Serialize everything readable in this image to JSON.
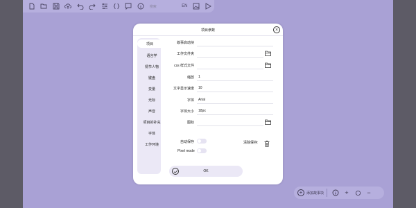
{
  "toolbar": {
    "search_placeholder": "搜索",
    "language": "EN",
    "icons": [
      "new-file-icon",
      "open-folder-icon",
      "save-icon",
      "cloud-upload-icon",
      "undo-icon",
      "redo-icon",
      "sliders-icon",
      "code-braces-icon",
      "comment-icon",
      "info-icon",
      "language-icon",
      "image-icon",
      "play-icon"
    ]
  },
  "dialog": {
    "title": "项目参数",
    "close_icon": "close-icon",
    "sidebar": {
      "items": [
        {
          "label": "项目",
          "active": true
        },
        {
          "label": "语言学"
        },
        {
          "label": "情节人物"
        },
        {
          "label": "键盘"
        },
        {
          "label": "变量"
        },
        {
          "label": "光标"
        },
        {
          "label": "声音"
        },
        {
          "label": "项目的补充"
        },
        {
          "label": "字体"
        },
        {
          "label": "工作环境"
        }
      ]
    },
    "fields": {
      "start_block": {
        "label": "故事启动块",
        "value": ""
      },
      "work_folder": {
        "label": "工作文件夹",
        "value": ""
      },
      "css_file": {
        "label": "css 样式文件",
        "value": ""
      },
      "zoom": {
        "label": "缩放",
        "value": "1"
      },
      "text_speed": {
        "label": "文字显示速度",
        "value": "10"
      },
      "font": {
        "label": "字体",
        "value": "Arial"
      },
      "font_size": {
        "label": "字体大小",
        "value": "18px"
      },
      "icon": {
        "label": "图标",
        "value": ""
      }
    },
    "autosave": {
      "label": "自动保存",
      "enabled": false
    },
    "pixel_mode": {
      "label": "Pixel mode",
      "enabled": false
    },
    "clear_save": {
      "label": "清除保存:"
    },
    "ok_label": "OK"
  },
  "bottombar": {
    "add_story_block": "添加故事块"
  },
  "colors": {
    "canvas": "#a9a1d5",
    "toolbar": "#b6afde",
    "panel_tint": "#ebe8f6",
    "frame": "#5d5b66"
  }
}
